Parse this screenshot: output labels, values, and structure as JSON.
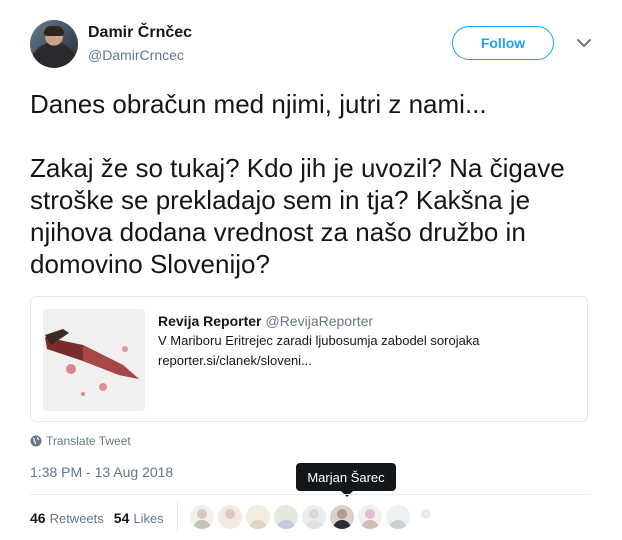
{
  "author": {
    "name": "Damir Črnčec",
    "handle": "@DamirCrncec"
  },
  "follow_label": "Follow",
  "tweet_text": "Danes obračun med njimi, jutri z nami...\n\nZakaj že so tukaj? Kdo jih je uvozil? Na čigave\nstroške se prekladajo sem in tja? Kakšna je\nnjihova dodana vrednost za našo družbo in\ndomovino Slovenijo?",
  "quote": {
    "name": "Revija Reporter",
    "handle": "@RevijaReporter",
    "text": "V Mariboru Eritrejec zaradi ljubosumja zabodel sorojaka",
    "link": "reporter.si/clanek/sloveni..."
  },
  "translate_label": "Translate Tweet",
  "timestamp": "1:38 PM - 13 Aug 2018",
  "tooltip": "Marjan Šarec",
  "stats": {
    "retweets_count": "46",
    "retweets_label": "Retweets",
    "likes_count": "54",
    "likes_label": "Likes"
  },
  "colors": {
    "accent": "#1da1f2",
    "secondary_text": "#657786"
  }
}
